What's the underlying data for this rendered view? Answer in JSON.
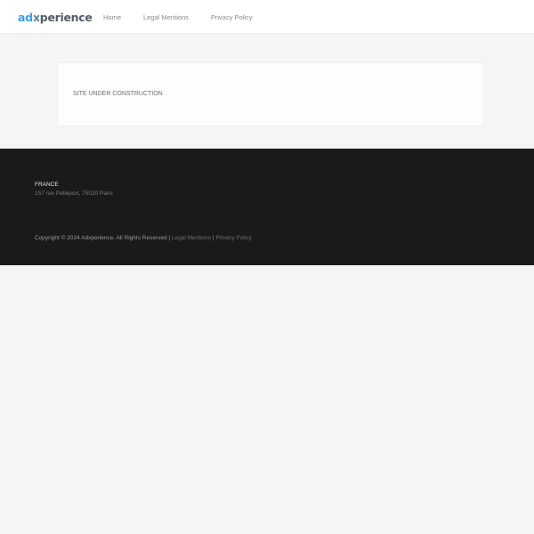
{
  "header": {
    "logo": {
      "part1": "ad",
      "part3": "perience"
    },
    "nav": [
      {
        "label": "Home"
      },
      {
        "label": "Legal Mentions"
      },
      {
        "label": "Privacy Policy"
      }
    ]
  },
  "main": {
    "message": "SITE UNDER CONSTRUCTION"
  },
  "footer": {
    "country": "FRANCE",
    "address": "157 rue Pelleport, 75020 Paris",
    "copyright": "Copyright © 2024 Adxperience. All Rights Reserved |",
    "links": [
      {
        "label": "Legal Mentions"
      },
      {
        "label": "Privacy Policy"
      }
    ],
    "separator": "|"
  },
  "colors": {
    "accent": "#3aa0e0",
    "footer_bg": "#1a1a1a",
    "page_bg": "#f5f5f5"
  }
}
